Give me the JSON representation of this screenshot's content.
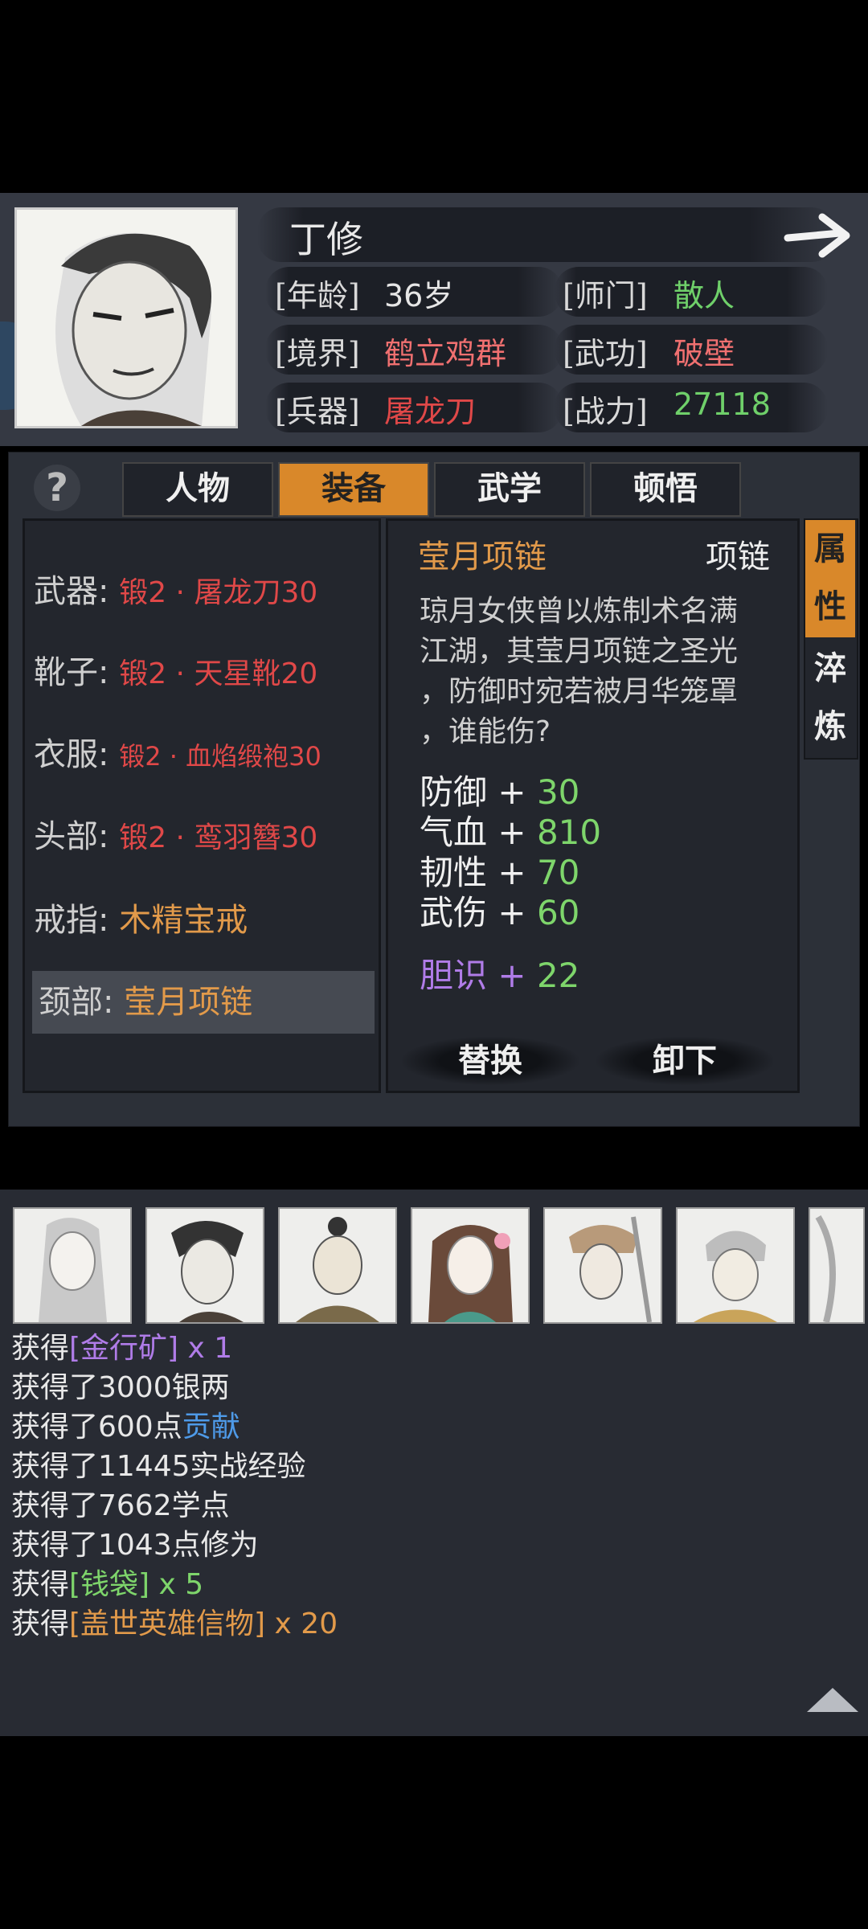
{
  "character": {
    "name": "丁修",
    "age_label": "[年龄]",
    "age": "36岁",
    "sect_label": "[师门]",
    "sect": "散人",
    "realm_label": "[境界]",
    "realm": "鹤立鸡群",
    "martial_label": "[武功]",
    "martial": "破壁",
    "weapon_label": "[兵器]",
    "weapon": "屠龙刀",
    "power_label": "[战力]",
    "power": "27118"
  },
  "tabs": [
    "人物",
    "装备",
    "武学",
    "顿悟"
  ],
  "active_tab": "装备",
  "help_icon": "?",
  "equipment": [
    {
      "slot": "武器:",
      "item": "锻2 · 屠龙刀30"
    },
    {
      "slot": "靴子:",
      "item": "锻2 · 天星靴20"
    },
    {
      "slot": "衣服:",
      "item": "锻2 · 血焰缎袍30"
    },
    {
      "slot": "头部:",
      "item": "锻2 · 鸾羽簪30"
    },
    {
      "slot": "戒指:",
      "item": "木精宝戒"
    },
    {
      "slot": "颈部:",
      "item": "莹月项链"
    }
  ],
  "detail": {
    "name": "莹月项链",
    "type": "项链",
    "description": [
      "琼月女侠曾以炼制术名满",
      "江湖，其莹月项链之圣光",
      "，防御时宛若被月华笼罩",
      "，谁能伤?"
    ],
    "stats": [
      {
        "label": "防御",
        "plus": "+",
        "value": "30"
      },
      {
        "label": "气血",
        "plus": "+",
        "value": "810"
      },
      {
        "label": "韧性",
        "plus": "+",
        "value": "70"
      },
      {
        "label": "武伤",
        "plus": "+",
        "value": "60"
      }
    ],
    "special": {
      "label": "胆识",
      "plus": "+",
      "value": "22"
    },
    "replace_button": "替换",
    "unequip_button": "卸下"
  },
  "side_tabs": [
    {
      "chars": [
        "属",
        "性"
      ]
    },
    {
      "chars": [
        "淬",
        "炼"
      ]
    }
  ],
  "logs": [
    {
      "prefix": "获得",
      "hl": "[金行矿]",
      "suffix": " x 1",
      "hl_color": "purple"
    },
    {
      "prefix": "获得了3000银两",
      "hl": "",
      "suffix": "",
      "hl_color": ""
    },
    {
      "prefix": "获得了600点",
      "hl": "贡献",
      "suffix": "",
      "hl_color": "blue"
    },
    {
      "prefix": "获得了11445实战经验",
      "hl": "",
      "suffix": "",
      "hl_color": ""
    },
    {
      "prefix": "获得了7662学点",
      "hl": "",
      "suffix": "",
      "hl_color": ""
    },
    {
      "prefix": "获得了1043点修为",
      "hl": "",
      "suffix": "",
      "hl_color": ""
    },
    {
      "prefix": "获得",
      "hl": "[钱袋]",
      "suffix": " x 5",
      "hl_color": "green"
    },
    {
      "prefix": "获得",
      "hl": "[盖世英雄信物]",
      "suffix": " x 20",
      "hl_color": "orange"
    }
  ],
  "colors": {
    "accent": "#d9882a",
    "red": "#e04848",
    "green": "#7ed56b",
    "purple": "#b07ce8",
    "blue": "#4e9ae8",
    "orange": "#e29a4a"
  }
}
